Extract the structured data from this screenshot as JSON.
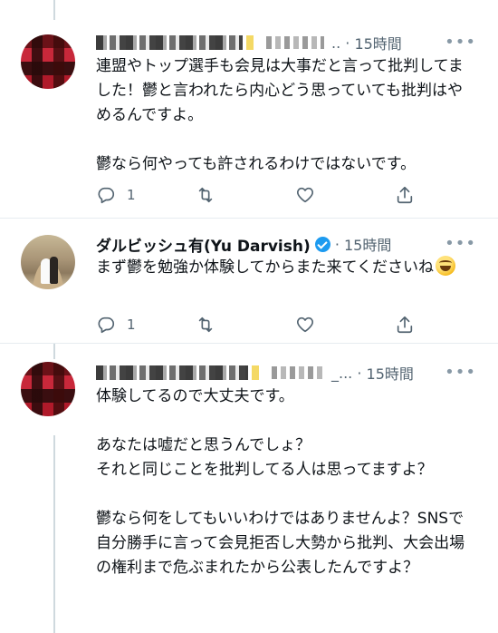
{
  "tweets": [
    {
      "author_hidden": true,
      "name_suffix": "..",
      "time": "15時間",
      "more": "•••",
      "paragraphs": [
        "連盟やトップ選手も会見は大事だと言って批判してました！鬱と言われたら内心どう思っていても批判はやめるんですよ。",
        "鬱なら何やっても許されるわけではないです。"
      ],
      "reply_count": "1",
      "retweet_count": "",
      "like_count": ""
    },
    {
      "author_name": "ダルビッシュ有(Yu Darvish)",
      "verified": true,
      "time": "15時間",
      "more": "•••",
      "text_main": "まず鬱を勉強か体験してからまた来てください",
      "text_tail": "ね",
      "emoji": "grinning-face",
      "reply_count": "1",
      "retweet_count": "",
      "like_count": ""
    },
    {
      "author_hidden": true,
      "name_suffix": "_...",
      "time": "15時間",
      "more": "•••",
      "paragraphs": [
        "体験してるので大丈夫です。",
        "あなたは嘘だと思うんでしょ？\nそれと同じことを批判してる人は思ってますよ？",
        "鬱なら何をしてもいいわけではありませんよ？SNSで自分勝手に言って会見拒否し大勢から批判、大会出場の権利まで危ぶまれたから公表したんですよ？"
      ]
    }
  ],
  "icons": {
    "reply": "reply-icon",
    "retweet": "retweet-icon",
    "like": "heart-icon",
    "share": "share-icon",
    "verified": "verified-badge-icon",
    "more": "more-icon"
  },
  "colors": {
    "text": "#0f1419",
    "secondary": "#536471",
    "verified": "#1d9bf0",
    "divider": "#e6ecf0",
    "thread_line": "#cfd9de"
  }
}
